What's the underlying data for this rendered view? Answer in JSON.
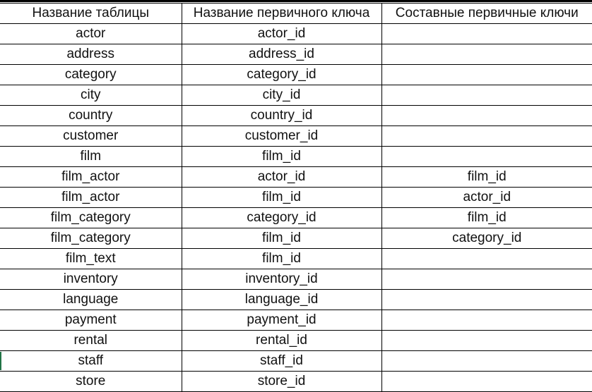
{
  "table": {
    "headers": [
      "Название таблицы",
      "Название первичного ключа",
      "Составные первичные ключи"
    ],
    "rows": [
      [
        "actor",
        "actor_id",
        ""
      ],
      [
        "address",
        "address_id",
        ""
      ],
      [
        "category",
        "category_id",
        ""
      ],
      [
        "city",
        "city_id",
        ""
      ],
      [
        "country",
        "country_id",
        ""
      ],
      [
        "customer",
        "customer_id",
        ""
      ],
      [
        "film",
        "film_id",
        ""
      ],
      [
        "film_actor",
        "actor_id",
        "film_id"
      ],
      [
        "film_actor",
        "film_id",
        "actor_id"
      ],
      [
        "film_category",
        "category_id",
        "film_id"
      ],
      [
        "film_category",
        "film_id",
        "category_id"
      ],
      [
        "film_text",
        "film_id",
        ""
      ],
      [
        "inventory",
        "inventory_id",
        ""
      ],
      [
        "language",
        "language_id",
        ""
      ],
      [
        "payment",
        "payment_id",
        ""
      ],
      [
        "rental",
        "rental_id",
        ""
      ],
      [
        "staff",
        "staff_id",
        ""
      ],
      [
        "store",
        "store_id",
        ""
      ]
    ]
  },
  "colors": {
    "grid": "#000000",
    "text": "#111111",
    "selection_marker": "#217346"
  }
}
